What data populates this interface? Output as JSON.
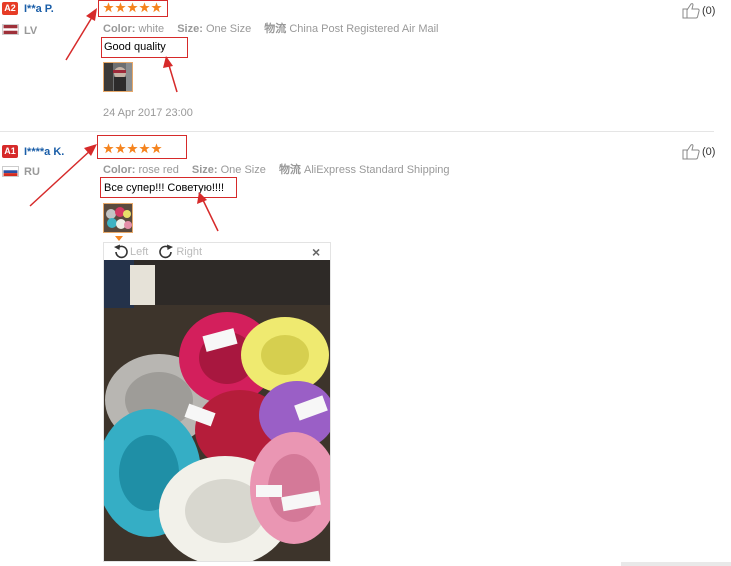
{
  "reviews": [
    {
      "badge": "A2",
      "badge_color": "#e63c26",
      "name": "I**a P.",
      "country": "LV",
      "stars": 5,
      "color_label": "Color:",
      "color_value": "white",
      "size_label": "Size:",
      "size_value": "One Size",
      "logistics_label": "物流",
      "logistics_value": "China Post Registered Air Mail",
      "comment": "Good quality",
      "date": "24 Apr 2017 23:00",
      "helpful_count": "(0)"
    },
    {
      "badge": "A1",
      "badge_color": "#d62a2a",
      "name": "I****a K.",
      "country": "RU",
      "stars": 5,
      "color_label": "Color:",
      "color_value": "rose red",
      "size_label": "Size:",
      "size_value": "One Size",
      "logistics_label": "物流",
      "logistics_value": "AliExpress Standard Shipping",
      "comment": "Все супер!!! Советую!!!!",
      "helpful_count": "(0)"
    }
  ],
  "viewer": {
    "rotate_left": "Left",
    "rotate_right": "Right",
    "close": "×"
  },
  "colors": {
    "accent_star": "#f5841f",
    "annotation_red": "#d62a2a"
  }
}
